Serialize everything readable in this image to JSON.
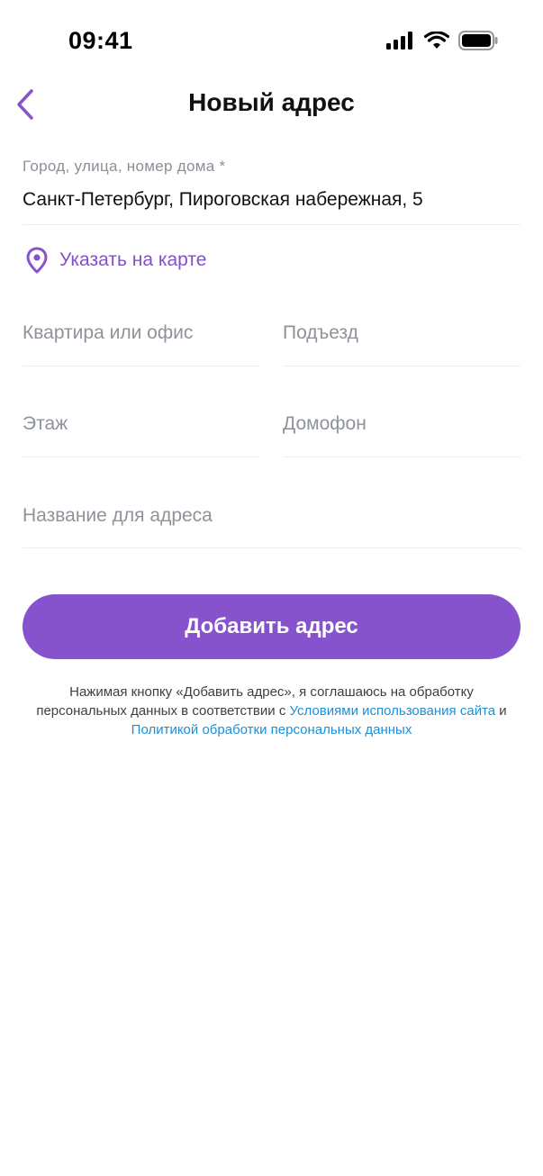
{
  "status_bar": {
    "time": "09:41"
  },
  "nav": {
    "title": "Новый адрес"
  },
  "address": {
    "label": "Город, улица, номер дома *",
    "value": "Санкт-Петербург, Пироговская набережная, 5"
  },
  "map_link": {
    "label": "Указать на карте"
  },
  "fields": {
    "apartment_placeholder": "Квартира или офис",
    "entrance_placeholder": "Подъезд",
    "floor_placeholder": "Этаж",
    "intercom_placeholder": "Домофон",
    "name_placeholder": "Название для адреса"
  },
  "submit": {
    "label": "Добавить адрес"
  },
  "consent": {
    "text_before": "Нажимая кнопку «Добавить адрес», я соглашаюсь на обработку персональных данных в соответствии с ",
    "terms_link": "Условиями использования сайта",
    "conjunction": " и ",
    "policy_link": "Политикой обработки персональных данных"
  },
  "colors": {
    "accent": "#8653cc",
    "link": "#1c8fd6",
    "placeholder": "#8e939b"
  }
}
